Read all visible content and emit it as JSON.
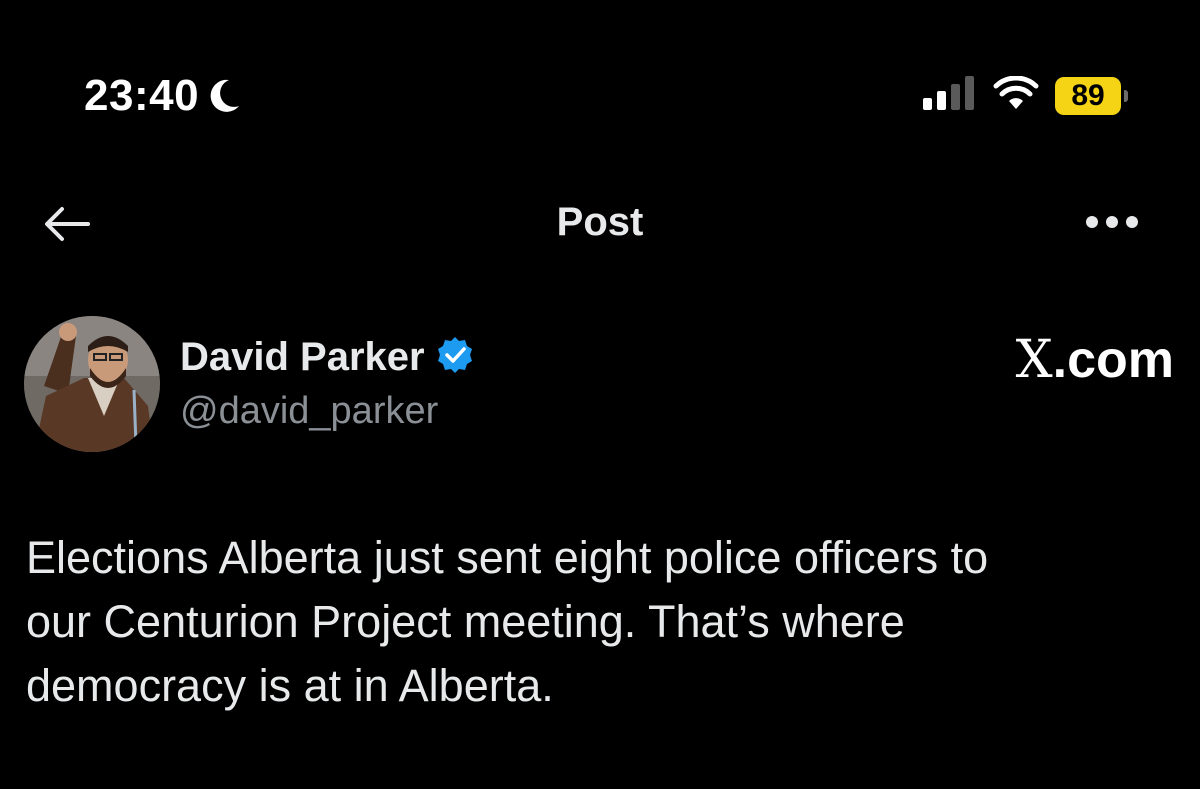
{
  "status_bar": {
    "time": "23:40",
    "battery_level": "89",
    "icons": [
      "moon-icon",
      "signal-icon",
      "wifi-icon",
      "battery-icon"
    ],
    "battery_color": "#f5d415"
  },
  "nav": {
    "title": "Post",
    "back_icon": "back-arrow-icon",
    "more_icon": "more-options-icon"
  },
  "post": {
    "author": {
      "display_name": "David Parker",
      "handle": "@david_parker",
      "verified": true,
      "verified_color": "#1d9bf0"
    },
    "site_label_x": "X",
    "site_label_rest": ".com",
    "text_lines": [
      "Elections Alberta just sent eight police officers to",
      "our Centurion Project meeting. That’s where",
      "democracy is at in Alberta."
    ]
  },
  "colors": {
    "background": "#000000",
    "primary_text": "#e7e9ea",
    "secondary_text": "#8b9096"
  }
}
